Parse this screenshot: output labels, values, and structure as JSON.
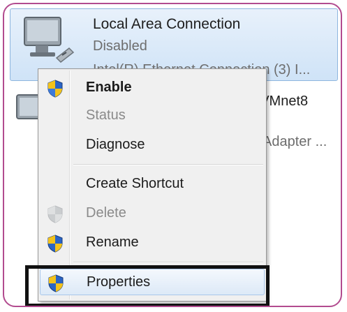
{
  "connection": {
    "title": "Local Area Connection",
    "status": "Disabled",
    "adapter": "Intel(R) Ethernet Connection (3) I..."
  },
  "background": {
    "vmnet_fragment": "r VMnet8",
    "adapter_fragment": "Adapter ..."
  },
  "context_menu": {
    "items": [
      {
        "label": "Enable",
        "icon": "uac-shield-icon",
        "enabled": true,
        "bold": true
      },
      {
        "label": "Status",
        "icon": "",
        "enabled": false
      },
      {
        "label": "Diagnose",
        "icon": "",
        "enabled": true
      },
      {
        "label": "Create Shortcut",
        "icon": "",
        "enabled": true
      },
      {
        "label": "Delete",
        "icon": "uac-shield-icon",
        "enabled": false
      },
      {
        "label": "Rename",
        "icon": "uac-shield-icon",
        "enabled": true
      },
      {
        "label": "Properties",
        "icon": "uac-shield-icon",
        "enabled": true,
        "highlighted": true
      }
    ]
  },
  "colors": {
    "frame_border": "#b24b8f",
    "selection_bg": "#cfe3f7",
    "menu_bg": "#f0f0f0",
    "annotation_box": "#111111"
  }
}
